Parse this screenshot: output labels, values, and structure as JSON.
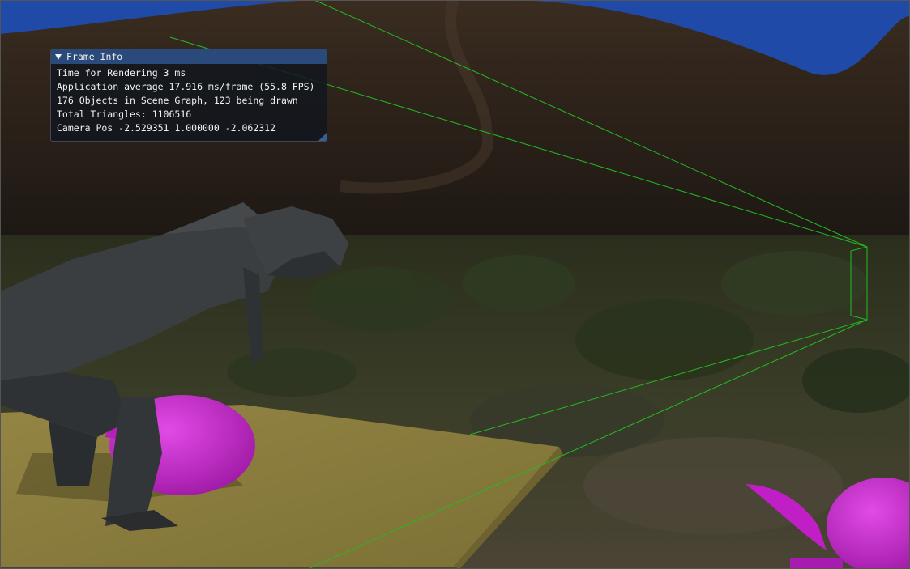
{
  "frame_info": {
    "title": "Frame Info",
    "lines": [
      "Time for Rendering 3 ms",
      "Application average 17.916 ms/frame (55.8 FPS)",
      "176 Objects in Scene Graph, 123 being drawn",
      "Total Triangles: 1106516",
      "Camera Pos -2.529351 1.000000 -2.062312"
    ]
  },
  "colors": {
    "sky": "#1f4aa8",
    "frustum_lines": "#22bb22",
    "ground_plate": "#8a7d3e",
    "teapot": "#c01fc6",
    "dinosaur": "#3b3f42",
    "titlebar": "#294a7a"
  },
  "icons": {
    "collapse": "collapse-arrow-icon"
  }
}
